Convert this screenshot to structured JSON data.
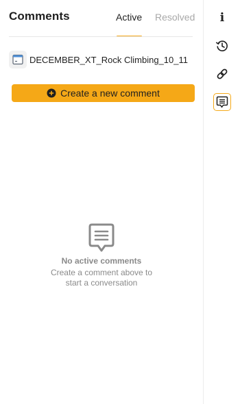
{
  "header": {
    "title": "Comments",
    "tabs": [
      {
        "label": "Active",
        "active": true
      },
      {
        "label": "Resolved",
        "active": false
      }
    ]
  },
  "file": {
    "name": "DECEMBER_XT_Rock Climbing_10_11",
    "icon": "file-window-icon"
  },
  "create_button": {
    "label": "Create a new comment",
    "icon": "plus-circle-icon"
  },
  "empty_state": {
    "icon": "comment-bubble-icon",
    "title": "No active comments",
    "subtitle_line1": "Create a comment above to",
    "subtitle_line2": "start a conversation"
  },
  "rail": {
    "items": [
      {
        "name": "info-icon",
        "glyph": "i"
      },
      {
        "name": "history-icon"
      },
      {
        "name": "link-icon"
      },
      {
        "name": "comments-icon",
        "selected": true
      }
    ]
  },
  "colors": {
    "accent": "#f5a817",
    "muted_text": "#8a8a8a",
    "inactive_tab": "#a8a8a8"
  }
}
